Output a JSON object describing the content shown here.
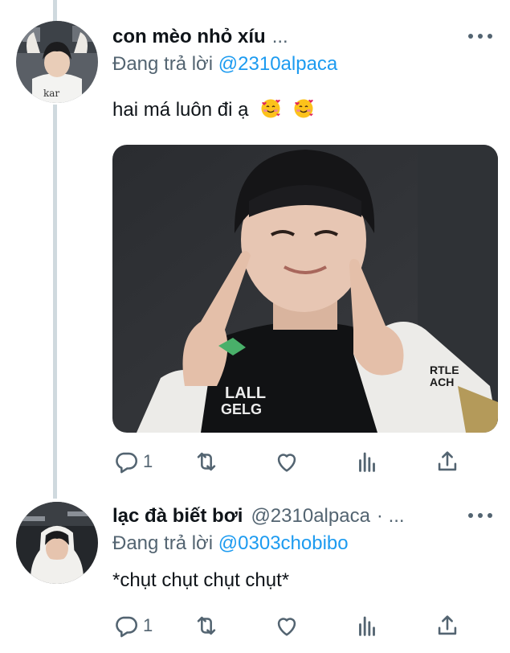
{
  "tweets": [
    {
      "display_name": "con mèo nhỏ xíu",
      "handle": "",
      "header_tail": "...",
      "replying_prefix": "Đang trả lời",
      "replying_to": "@2310alpaca",
      "text": "hai má luôn đi ạ",
      "emojis": [
        "smiling-face-with-hearts-icon",
        "smiling-face-with-hearts-icon"
      ],
      "has_media": true,
      "actions": {
        "reply_count": "1",
        "retweet_count": "",
        "like_count": ""
      }
    },
    {
      "display_name": "lạc đà biết bơi",
      "handle": "@2310alpaca",
      "header_tail": "· ...",
      "replying_prefix": "Đang trả lời",
      "replying_to": "@0303chobibo",
      "text": "*chụt chụt chụt chụt*",
      "has_media": false,
      "actions": {
        "reply_count": "1",
        "retweet_count": "",
        "like_count": ""
      }
    }
  ],
  "icons": [
    "reply-icon",
    "retweet-icon",
    "like-icon",
    "analytics-icon",
    "share-icon",
    "more-icon"
  ],
  "colors": {
    "accent": "#1d9bf0",
    "secondary_text": "#536471",
    "primary_text": "#0f1419",
    "thread_line": "#cfd9de"
  }
}
